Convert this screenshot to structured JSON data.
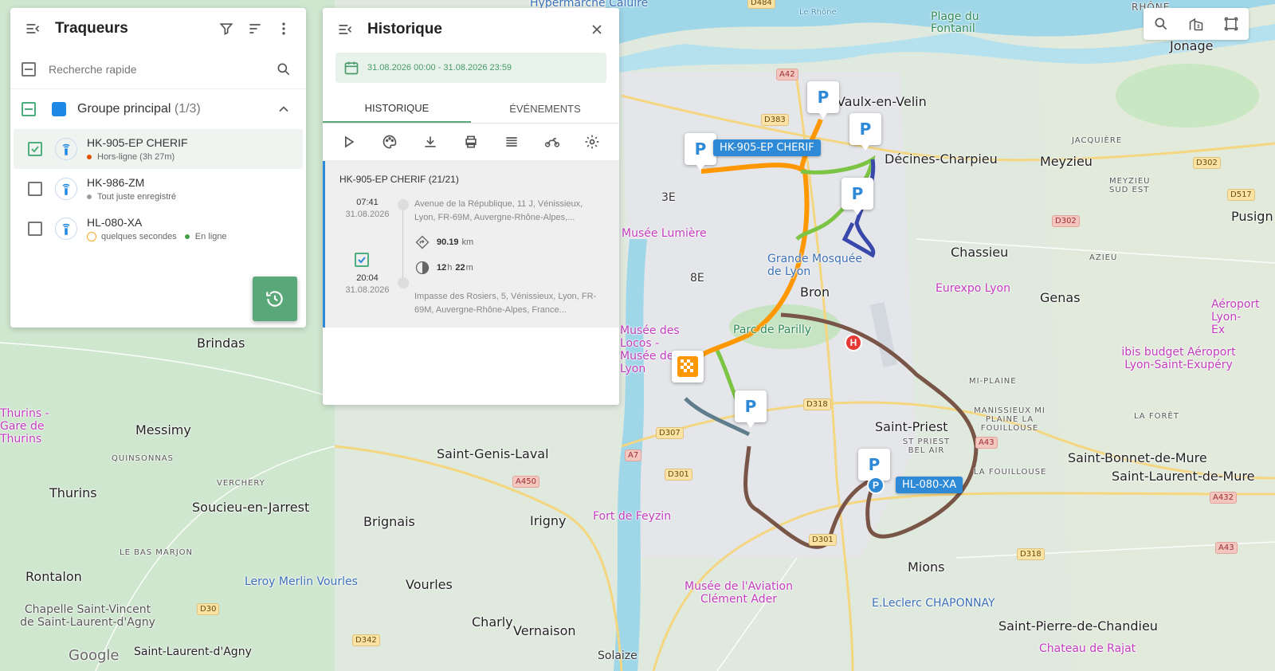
{
  "trackers_panel": {
    "title": "Traqueurs",
    "search_placeholder": "Recherche rapide",
    "group": {
      "name": "Groupe principal",
      "count": "(1/3)",
      "color": "#1e88e5"
    },
    "items": [
      {
        "name": "HK-905-EP CHERIF",
        "status": "Hors-ligne (3h 27m)",
        "status_color": "#e65100",
        "checked": true
      },
      {
        "name": "HK-986-ZM",
        "status": "Tout juste enregistré",
        "status_color": "#9e9e9e",
        "checked": false
      },
      {
        "name": "HL-080-XA",
        "status": "quelques secondes",
        "status2": "En ligne",
        "status2_color": "#43a047",
        "checked": false
      }
    ]
  },
  "history_panel": {
    "title": "Historique",
    "date_range": "31.08.2026 00:00 - 31.08.2026 23:59",
    "tabs": [
      "HISTORIQUE",
      "ÉVÉNEMENTS"
    ],
    "trip": {
      "title": "HK-905-EP CHERIF  (21/21)",
      "start_time": "07:41",
      "start_date": "31.08.2026",
      "start_address": "Avenue de la République, 11 J, Vénissieux, Lyon, FR-69M, Auvergne-Rhône-Alpes,...",
      "distance": "90.19",
      "distance_unit": "km",
      "duration_h": "12",
      "duration_h_unit": "h",
      "duration_m": "22",
      "duration_m_unit": "m",
      "end_time": "20:04",
      "end_date": "31.08.2026",
      "end_address": "Impasse des Rosiers, 5, Vénissieux, Lyon, FR-69M, Auvergne-Rhône-Alpes, France..."
    }
  },
  "map": {
    "vehicle_tags": [
      "HK-905-EP CHERIF",
      "HL-080-XA"
    ],
    "parking_letter": "P",
    "places": [
      {
        "t": "Jonage",
        "c": "big"
      },
      {
        "t": "Décines-Charpieu",
        "c": "big"
      },
      {
        "t": "Meyzieu",
        "c": "big"
      },
      {
        "t": "Chassieu",
        "c": "big"
      },
      {
        "t": "Bron",
        "c": "big"
      },
      {
        "t": "Genas",
        "c": "big"
      },
      {
        "t": "Saint-Priest",
        "c": "big"
      },
      {
        "t": "Mions",
        "c": "big"
      },
      {
        "t": "Brindas",
        "c": "big"
      },
      {
        "t": "Messimy",
        "c": "big"
      },
      {
        "t": "Thurins",
        "c": "big"
      },
      {
        "t": "Soucieu-en-Jarrest",
        "c": "big"
      },
      {
        "t": "Saint-Genis-Laval",
        "c": "big"
      },
      {
        "t": "Brignais",
        "c": "big"
      },
      {
        "t": "Irigny",
        "c": "big"
      },
      {
        "t": "Rontalon",
        "c": "big"
      },
      {
        "t": "Vourles",
        "c": "big"
      },
      {
        "t": "Charly",
        "c": "big"
      },
      {
        "t": "Vernaison",
        "c": "big"
      },
      {
        "t": "Pusign",
        "c": "big"
      },
      {
        "t": "Saint-Bonnet-de-Mure",
        "c": "big"
      },
      {
        "t": "Saint-Laurent-de-Mure",
        "c": "big"
      },
      {
        "t": "Saint-Pierre-de-Chandieu",
        "c": "big"
      },
      {
        "t": "Saint-Laurent-d'Agny",
        "c": "big"
      },
      {
        "t": "Vaulx-en-Velin",
        "c": "big"
      },
      {
        "t": "Grande Mosquée de Lyon",
        "c": "poi"
      },
      {
        "t": "Eurexpo Lyon",
        "c": "poi-pink"
      },
      {
        "t": "Parc de Parilly",
        "c": "poi-green"
      },
      {
        "t": "Fort de Feyzin",
        "c": "poi-pink"
      },
      {
        "t": "Musée de l'Aviation Clément Ader",
        "c": "poi-pink"
      },
      {
        "t": "E.Leclerc CHAPONNAY",
        "c": "poi"
      },
      {
        "t": "Leroy Merlin Vourles",
        "c": "poi"
      },
      {
        "t": "Chapelle Saint-Vincent de Saint-Laurent-d'Agny",
        "c": "med"
      },
      {
        "t": "Plage du Fontanil",
        "c": "poi-green"
      },
      {
        "t": "Hypermarché Caluire",
        "c": "poi"
      },
      {
        "t": "ibis budget Aéroport Lyon-Saint-Exupéry",
        "c": "poi-pink"
      },
      {
        "t": "Aéroport Lyon-Ex",
        "c": "poi-pink"
      },
      {
        "t": "Chateau de Rajat",
        "c": "poi-pink"
      },
      {
        "t": "Musée Lumière",
        "c": "poi-pink"
      },
      {
        "t": "Musée des Locos - Musée de Lyon",
        "c": "poi-pink"
      },
      {
        "t": "Thurins - Gare de Thurins",
        "c": "poi-pink"
      },
      {
        "t": "JACQUIÈRE",
        "c": "small"
      },
      {
        "t": "MEYZIEU SUD EST",
        "c": "small"
      },
      {
        "t": "AZIEU",
        "c": "small"
      },
      {
        "t": "MI-PLAINE",
        "c": "small"
      },
      {
        "t": "MANISSIEUX MI PLAINE LA FOUILLOUSE",
        "c": "small"
      },
      {
        "t": "LA FORÊT",
        "c": "small"
      },
      {
        "t": "LA FOUILLOUSE",
        "c": "small"
      },
      {
        "t": "ST PRIEST BEL AIR",
        "c": "small"
      },
      {
        "t": "QUINSONNAS",
        "c": "small"
      },
      {
        "t": "VERCHERY",
        "c": "small"
      },
      {
        "t": "LE BAS MARJON",
        "c": "small"
      },
      {
        "t": "RHÔNE",
        "c": "small"
      },
      {
        "t": "3E",
        "c": "med"
      },
      {
        "t": "8E",
        "c": "med"
      },
      {
        "t": "Solaize",
        "c": "med"
      },
      {
        "t": "Le Rhône",
        "c": "small"
      },
      {
        "t": "Google",
        "c": "big"
      }
    ],
    "roads": [
      "A42",
      "D383",
      "D302",
      "D517",
      "A43",
      "D318",
      "D307",
      "A7",
      "D301",
      "A450",
      "A432",
      "D30",
      "D342",
      "D484"
    ]
  }
}
